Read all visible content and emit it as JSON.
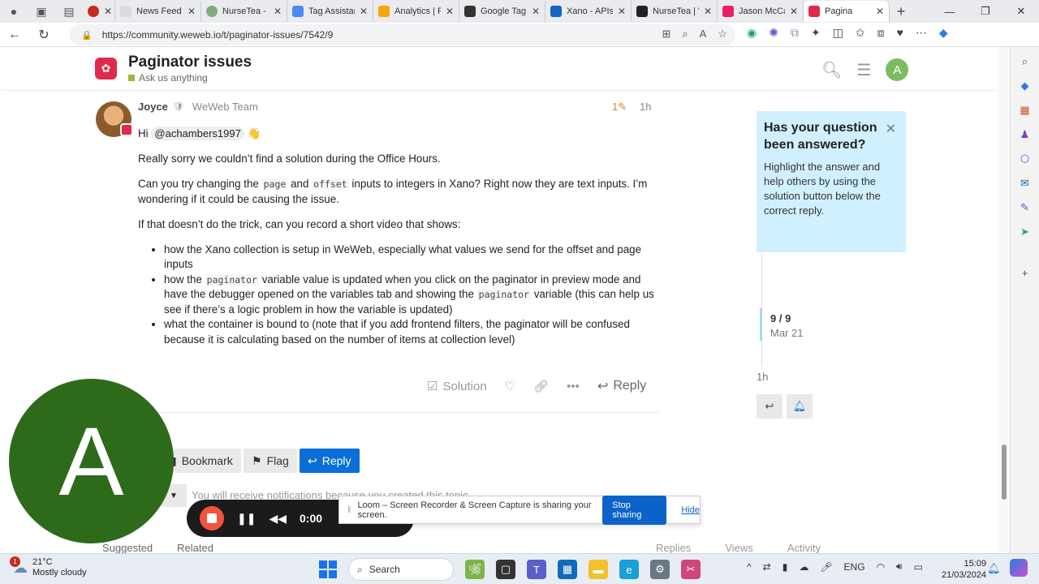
{
  "browser": {
    "tabs": [
      {
        "label": "",
        "fav": "#e0294e",
        "close": "✕"
      },
      {
        "label": "News Feed",
        "fav": "#dcdcdc",
        "close": "✕"
      },
      {
        "label": "NurseTea -",
        "fav": "#7cae7a",
        "close": "✕"
      },
      {
        "label": "Tag Assistant",
        "fav": "#4a8af4",
        "close": "✕"
      },
      {
        "label": "Analytics | F",
        "fav": "#f4a70a",
        "close": "✕"
      },
      {
        "label": "Google Tag",
        "fav": "#333333",
        "close": "✕"
      },
      {
        "label": "Xano - APIs",
        "fav": "#1565c0",
        "close": "✕"
      },
      {
        "label": "NurseTea | W",
        "fav": "#222222",
        "close": "✕"
      },
      {
        "label": "Jason McCa",
        "fav": "#e91e63",
        "close": "✕"
      },
      {
        "label": "Pagina",
        "fav": "#e0294e",
        "close": "✕"
      }
    ],
    "new_tab": "+",
    "url": "https://community.weweb.io/t/paginator-issues/7542/9"
  },
  "header": {
    "title": "Paginator issues",
    "category": "Ask us anything",
    "avatar_letter": "A"
  },
  "post": {
    "username": "Joyce",
    "team": "WeWeb Team",
    "edits": "1",
    "time": "1h",
    "greeting": "Hi",
    "mention": "@achambers1997",
    "wave": "👋",
    "p1": "Really sorry we couldn’t find a solution during the Office Hours.",
    "p2a": "Can you try changing the",
    "p2_code1": "page",
    "p2b": "and",
    "p2_code2": "offset",
    "p2c": "inputs to integers in Xano? Right now they are text inputs. I’m wondering if it could be causing the issue.",
    "p3": "If that doesn’t do the trick, can you record a short video that shows:",
    "li1": "how the Xano collection is setup in WeWeb, especially what values we send for the offset and page inputs",
    "li2a": "how the",
    "li2_code1": "paginator",
    "li2b": "variable value is updated when you click on the paginator in preview mode and have the debugger opened on the variables tab and showing the",
    "li2_code2": "paginator",
    "li2c": "variable (this can help us see if there’s a logic problem in how the variable is updated)",
    "li3": "what the container is bound to (note that if you add frontend filters, the paginator will be confused because it is calculating based on the number of items at collection level)",
    "solution_label": "Solution",
    "reply_label": "Reply"
  },
  "footer": {
    "bookmark_label": "Bookmark",
    "flag_label": "Flag",
    "reply_label": "Reply",
    "notification_text": "You will receive notifications because you created this topic.",
    "tab_suggested": "Suggested",
    "tab_related": "Related",
    "col_replies": "Replies",
    "col_views": "Views",
    "col_activity": "Activity"
  },
  "sidebar": {
    "answer_title": "Has your question been answered?",
    "answer_body": "Highlight the answer and help others by using the solution button below the correct reply.",
    "timeline_count": "9 / 9",
    "timeline_date": "Mar 21",
    "timeline_recent": "1h"
  },
  "loom": {
    "avatar_letter": "A",
    "timer": "0:00",
    "banner_text": "Loom – Screen Recorder & Screen Capture is sharing your screen.",
    "stop_label": "Stop sharing",
    "hide_label": "Hide"
  },
  "taskbar": {
    "temperature": "21°C",
    "weather": "Mostly cloudy",
    "weather_badge": "1",
    "search_label": "Search",
    "lang": "ENG",
    "time": "15:09",
    "date": "21/03/2024"
  },
  "colors": {
    "brand": "#e0294e",
    "primary_button": "#0a6fd6",
    "answer_box": "#d1f0ff",
    "loom_avatar": "#2d6b1a",
    "record": "#f2533d"
  }
}
